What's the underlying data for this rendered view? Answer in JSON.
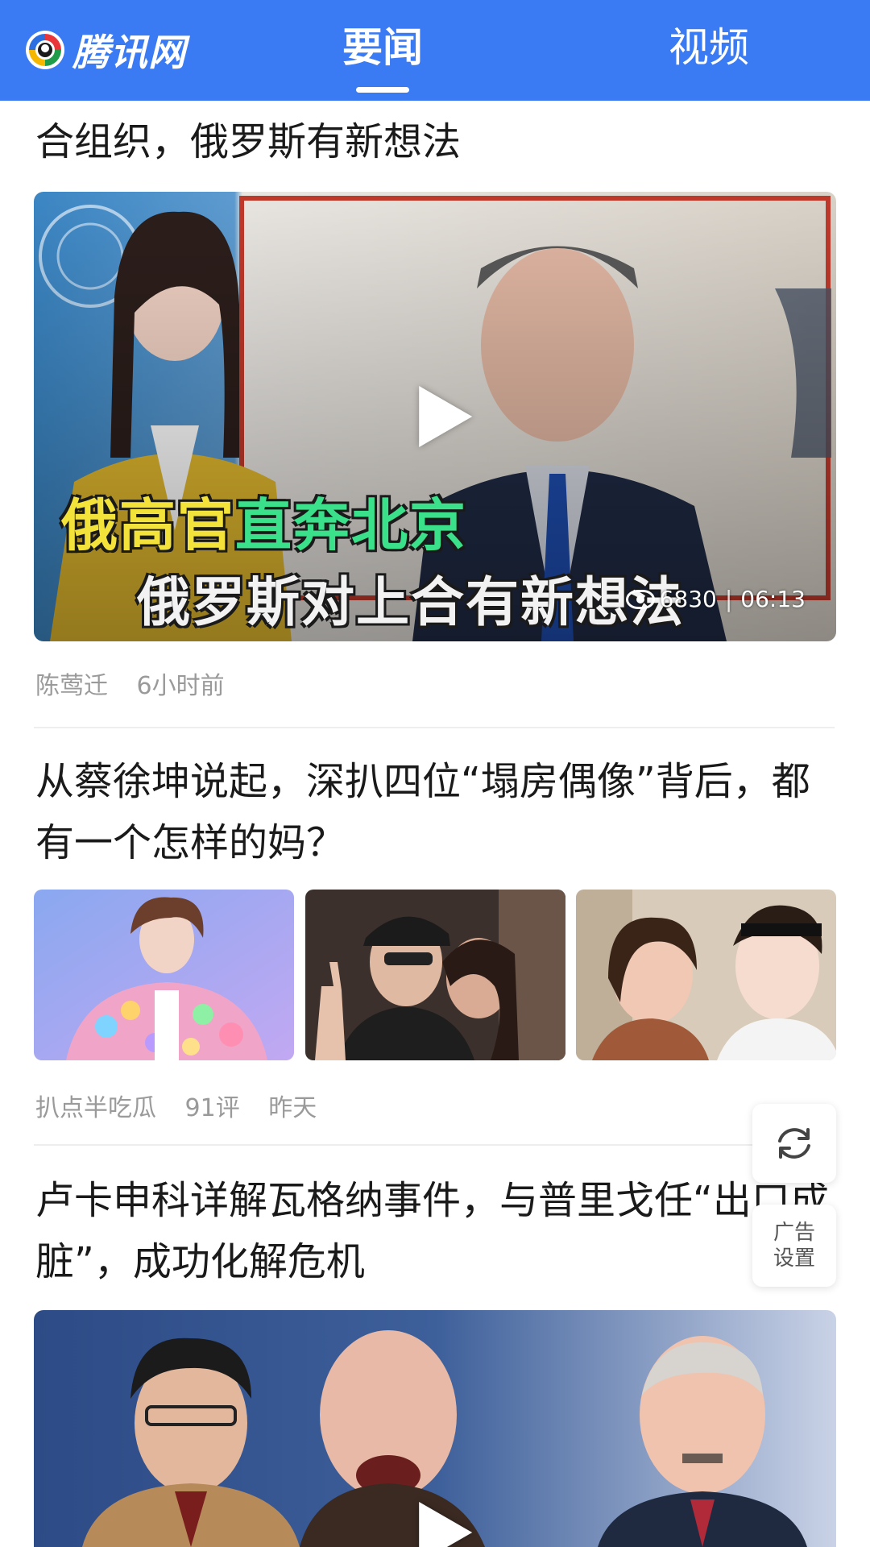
{
  "header": {
    "brand": "腾讯网",
    "tabs": [
      {
        "label": "要闻",
        "active": true
      },
      {
        "label": "视频",
        "active": false
      }
    ],
    "bg_color": "#3a7af2"
  },
  "feed": {
    "items": [
      {
        "title": "合组织，俄罗斯有新想法",
        "video": {
          "overlay_line1_a": "俄高官",
          "overlay_line1_b": "直奔北京",
          "overlay_line2": "俄罗斯对上合有新想法",
          "views": "6830",
          "duration": "06:13"
        },
        "meta": {
          "author": "陈莺迁",
          "time": "6小时前"
        }
      },
      {
        "title": "从蔡徐坤说起，深扒四位“塌房偶像”背后，都有一个怎样的妈？",
        "images": [
          "colorful-coat-portrait",
          "couple-selfie",
          "mother-son-selfie"
        ],
        "meta": {
          "author": "扒点半吃瓜",
          "comments": "91评",
          "time": "昨天"
        }
      },
      {
        "title": "卢卡申科详解瓦格纳事件，与普里戈任“出口成脏”，成功化解危机"
      }
    ]
  },
  "float": {
    "refresh_icon": "refresh-icon",
    "ad_settings_line1": "广告",
    "ad_settings_line2": "设置"
  }
}
